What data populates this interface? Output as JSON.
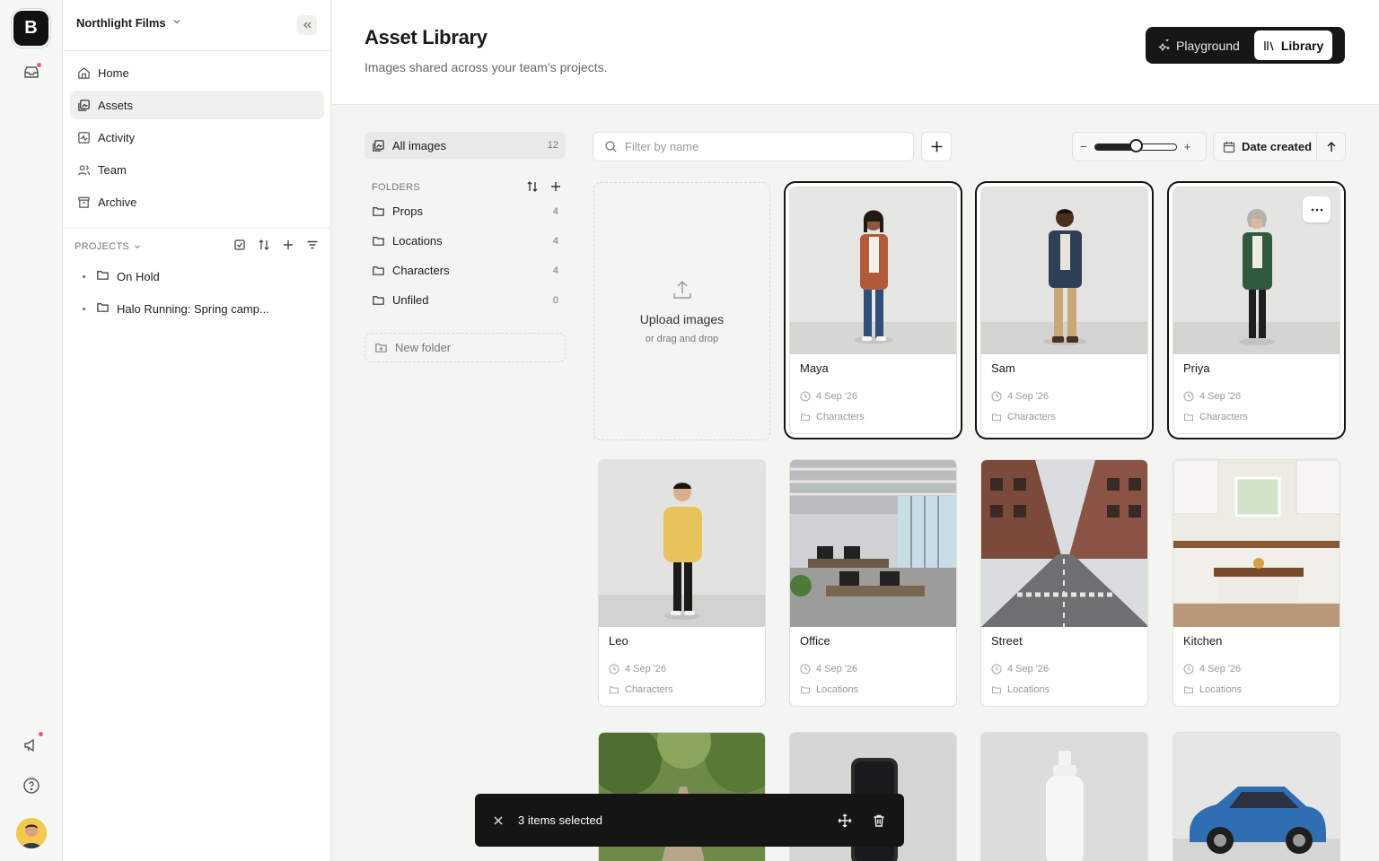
{
  "rail": {
    "logo_letter": "B",
    "accent": "#ec5a72"
  },
  "sidebar": {
    "workspace": "Northlight Films",
    "nav": [
      {
        "label": "Home",
        "icon": "home-icon"
      },
      {
        "label": "Assets",
        "icon": "assets-icon",
        "active": true
      },
      {
        "label": "Activity",
        "icon": "activity-icon"
      },
      {
        "label": "Team",
        "icon": "team-icon"
      },
      {
        "label": "Archive",
        "icon": "archive-icon"
      }
    ],
    "projects_label": "PROJECTS",
    "projects": [
      {
        "label": "On Hold"
      },
      {
        "label": "Halo Running: Spring camp..."
      }
    ]
  },
  "header": {
    "title": "Asset Library",
    "subtitle": "Images shared across your team’s projects.",
    "modes": [
      {
        "label": "Playground",
        "active": false
      },
      {
        "label": "Library",
        "active": true
      }
    ]
  },
  "folders_panel": {
    "all_images": {
      "label": "All images",
      "count": "12"
    },
    "folders_label": "FOLDERS",
    "folders": [
      {
        "label": "Props",
        "count": "4"
      },
      {
        "label": "Locations",
        "count": "4"
      },
      {
        "label": "Characters",
        "count": "4"
      },
      {
        "label": "Unfiled",
        "count": "0"
      }
    ],
    "new_folder": "New folder"
  },
  "toolbar": {
    "search_placeholder": "Filter by name",
    "zoom_level": 0.5,
    "zoom_minus": "−",
    "zoom_plus": "+",
    "sort_label": "Date created"
  },
  "upload": {
    "title": "Upload images",
    "subtitle": "or drag and drop"
  },
  "assets": [
    {
      "name": "Maya",
      "date": "4 Sep '26",
      "folder": "Characters",
      "selected": true
    },
    {
      "name": "Sam",
      "date": "4 Sep '26",
      "folder": "Characters",
      "selected": true
    },
    {
      "name": "Priya",
      "date": "4 Sep '26",
      "folder": "Characters",
      "selected": true
    },
    {
      "name": "Leo",
      "date": "4 Sep '26",
      "folder": "Characters",
      "selected": false
    },
    {
      "name": "Office",
      "date": "4 Sep '26",
      "folder": "Locations",
      "selected": false
    },
    {
      "name": "Street",
      "date": "4 Sep '26",
      "folder": "Locations",
      "selected": false
    },
    {
      "name": "Kitchen",
      "date": "4 Sep '26",
      "folder": "Locations",
      "selected": false
    }
  ],
  "selection_bar": {
    "text": "3 items selected"
  }
}
